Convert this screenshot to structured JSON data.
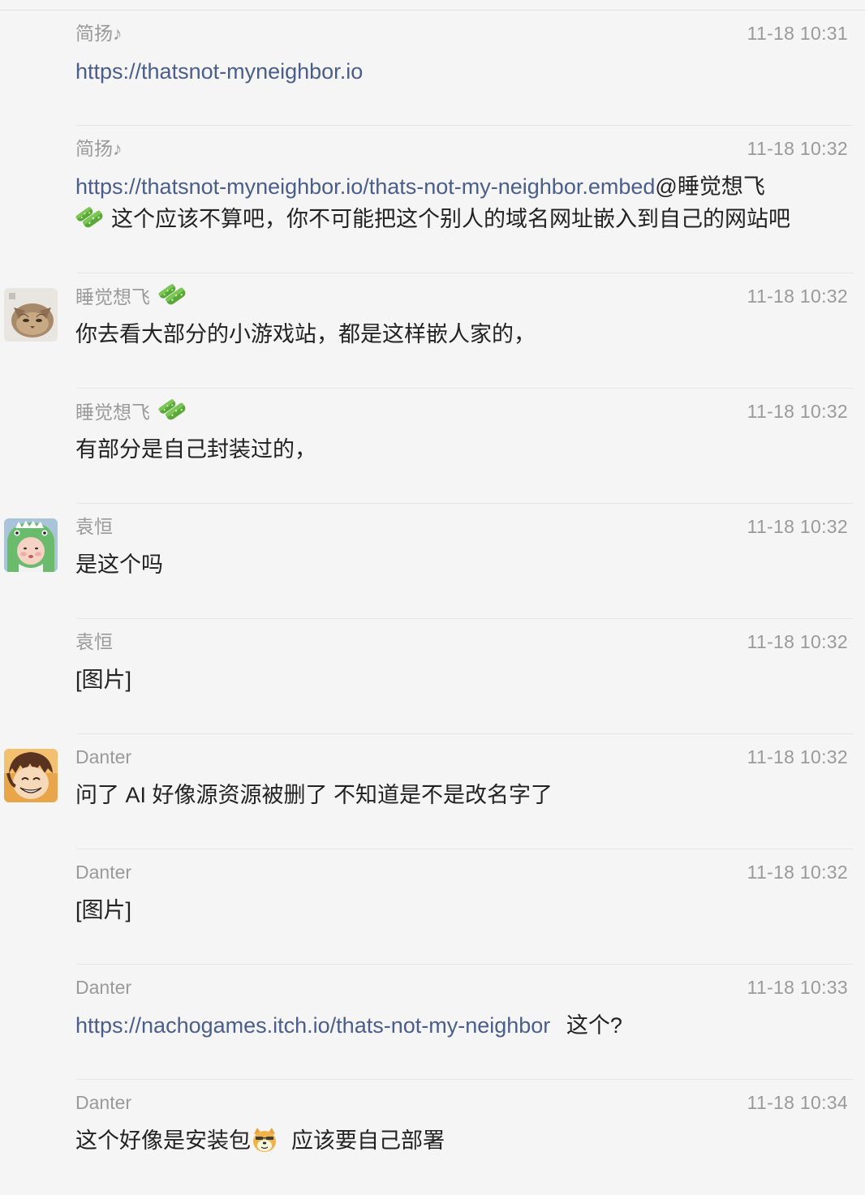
{
  "colors": {
    "background": "#f5f5f5",
    "meta_text": "#9a9a9a",
    "body_text": "#222222",
    "link": "#4a5d8c",
    "divider": "#e6e6e6"
  },
  "messages": [
    {
      "sender": "简扬♪",
      "time": "11-18 10:31",
      "link": "https://thatsnot-myneighbor.io"
    },
    {
      "sender": "简扬♪",
      "time": "11-18 10:32",
      "link": "https://thatsnot-myneighbor.io/thats-not-my-neighbor.embed",
      "mention": "@睡觉想飞",
      "text": "这个应该不算吧，你不可能把这个别人的域名网址嵌入到自己的网站吧",
      "emoji": "cucumber-emoji"
    },
    {
      "sender": "睡觉想飞",
      "sender_emoji": "cucumber-emoji",
      "avatar": "cat-avatar",
      "time": "11-18 10:32",
      "text": "你去看大部分的小游戏站，都是这样嵌人家的，"
    },
    {
      "sender": "睡觉想飞",
      "sender_emoji": "cucumber-emoji",
      "time": "11-18 10:32",
      "text": "有部分是自己封装过的，"
    },
    {
      "sender": "袁恒",
      "avatar": "baby-dino-avatar",
      "time": "11-18 10:32",
      "text": "是这个吗"
    },
    {
      "sender": "袁恒",
      "time": "11-18 10:32",
      "text": "[图片]"
    },
    {
      "sender": "Danter",
      "avatar": "anime-boy-avatar",
      "time": "11-18 10:32",
      "text": "问了 AI 好像源资源被删了 不知道是不是改名字了"
    },
    {
      "sender": "Danter",
      "time": "11-18 10:32",
      "text": "[图片]"
    },
    {
      "sender": "Danter",
      "time": "11-18 10:33",
      "link": "https://nachogames.itch.io/thats-not-my-neighbor",
      "text": "这个?"
    },
    {
      "sender": "Danter",
      "time": "11-18 10:34",
      "text": "这个好像是安装包",
      "emoji": "doge-emoji",
      "text_after": "应该要自己部署"
    }
  ]
}
